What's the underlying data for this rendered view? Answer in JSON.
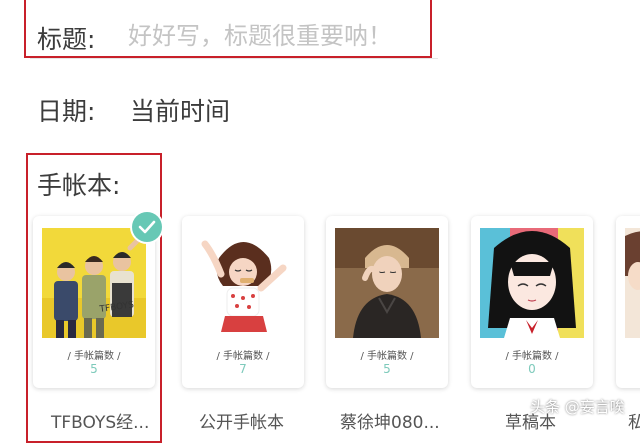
{
  "form": {
    "title_label": "标题:",
    "title_placeholder": "好好写，标题很重要呐！",
    "title_value": "",
    "date_label": "日期:",
    "date_value": "当前时间",
    "notebook_label": "手帐本:"
  },
  "notebooks": [
    {
      "name": "TFBOYS经...",
      "meta": "/ 手帐篇数 /",
      "count": "5",
      "selected": true
    },
    {
      "name": "公开手帐本",
      "meta": "/ 手帐篇数 /",
      "count": "7",
      "selected": false
    },
    {
      "name": "蔡徐坤080...",
      "meta": "/ 手帐篇数 /",
      "count": "5",
      "selected": false
    },
    {
      "name": "草稿本",
      "meta": "/ 手帐篇数 /",
      "count": "0",
      "selected": false
    }
  ],
  "partial_card_name": "私",
  "watermark": "头条 @妄言唉",
  "colors": {
    "highlight_border": "#c8202a",
    "accent_teal": "#67c8b5",
    "count_color": "#7ecabb",
    "placeholder": "#c4c4c4"
  },
  "icons": {
    "selected_badge": "check-icon"
  }
}
